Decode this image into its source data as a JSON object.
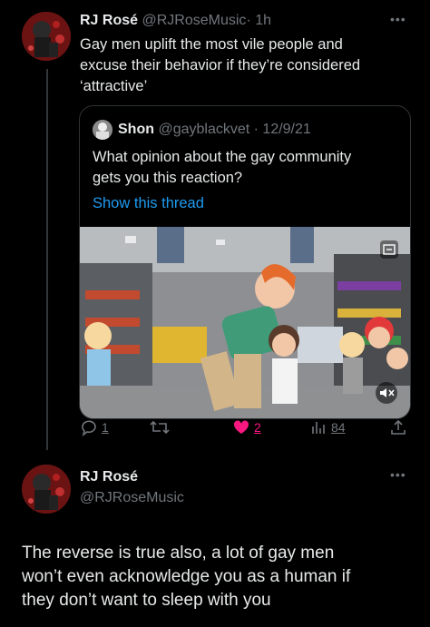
{
  "tweet": {
    "display_name": "RJ Rosé",
    "handle": "@RJRoseMusic",
    "time": "· 1h",
    "text_lines": [
      "Gay men uplift the most vile people and",
      "excuse their behavior  if they’re considered",
      "‘attractive’"
    ]
  },
  "quoted": {
    "display_name": "Shon",
    "handle": "@gayblackvet",
    "date": "· 12/9/21",
    "text_lines": [
      "What opinion about the gay community",
      "gets you this reaction?"
    ],
    "show_thread": "Show this thread"
  },
  "actions": {
    "replies": "1",
    "retweets": "",
    "likes": "2",
    "views": "84",
    "like_color": "#f91880"
  },
  "reply": {
    "display_name": "RJ Rosé",
    "handle": "@RJRoseMusic",
    "text_lines": [
      "The reverse is true also, a lot of gay men",
      "won’t even acknowledge you as a human if",
      "they don’t want to sleep with you"
    ]
  },
  "icons": {
    "more": "more-icon",
    "reply": "reply-icon",
    "retweet": "retweet-icon",
    "like": "heart-icon",
    "views": "views-icon",
    "share": "share-icon",
    "gif_badge": "gif-icon",
    "mute": "mute-icon"
  },
  "colors": {
    "background": "#000000",
    "text": "#e7e9ea",
    "muted": "#71767b",
    "link": "#1d9bf0",
    "border": "#2f3336"
  }
}
